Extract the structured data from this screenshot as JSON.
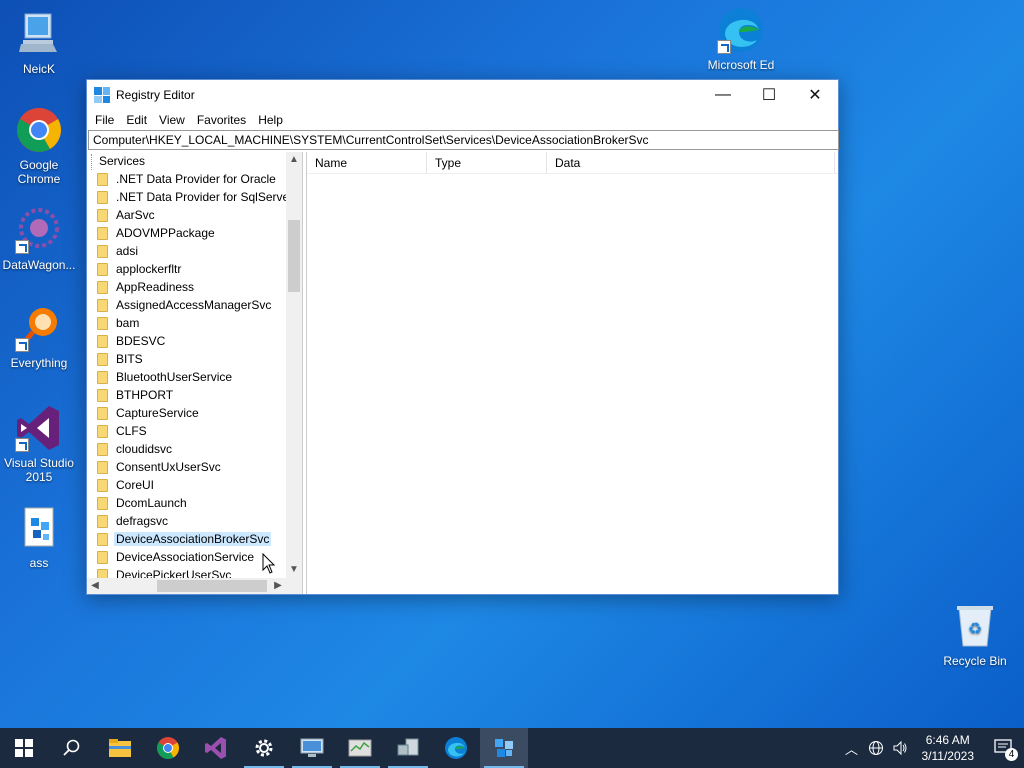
{
  "desktop": {
    "icons": [
      {
        "label": "NeicK",
        "icon": "computer-icon"
      },
      {
        "label": "Google Chrome",
        "icon": "chrome-icon"
      },
      {
        "label": "DataWagon...",
        "icon": "datawagon-icon"
      },
      {
        "label": "Everything",
        "icon": "everything-icon"
      },
      {
        "label": "Visual Studio 2015",
        "icon": "visual-studio-icon"
      },
      {
        "label": "ass",
        "icon": "file-icon"
      },
      {
        "label": "Microsoft Ed",
        "icon": "edge-icon"
      },
      {
        "label": "Recycle Bin",
        "icon": "recycle-bin-icon"
      }
    ]
  },
  "window": {
    "title": "Registry Editor",
    "minimize": "—",
    "maximize": "☐",
    "close": "✕",
    "menu": [
      "File",
      "Edit",
      "View",
      "Favorites",
      "Help"
    ],
    "address": "Computer\\HKEY_LOCAL_MACHINE\\SYSTEM\\CurrentControlSet\\Services\\DeviceAssociationBrokerSvc",
    "tree": {
      "root": "Services",
      "items": [
        ".NET Data Provider for Oracle",
        ".NET Data Provider for SqlServer",
        "AarSvc",
        "ADOVMPPackage",
        "adsi",
        "applockerfltr",
        "AppReadiness",
        "AssignedAccessManagerSvc",
        "bam",
        "BDESVC",
        "BITS",
        "BluetoothUserService",
        "BTHPORT",
        "CaptureService",
        "CLFS",
        "cloudidsvc",
        "ConsentUxUserSvc",
        "CoreUI",
        "DcomLaunch",
        "defragsvc",
        "DeviceAssociationBrokerSvc",
        "DeviceAssociationService",
        "DevicePickerUserSvc"
      ],
      "selected_index": 20
    },
    "columns": [
      "Name",
      "Type",
      "Data"
    ]
  },
  "taskbar": {
    "pinned": [
      "start-icon",
      "search-icon",
      "file-explorer-icon",
      "chrome-icon",
      "visual-studio-icon",
      "settings-icon",
      "remote-desktop-icon",
      "task-manager-icon",
      "network-computer-icon",
      "edge-icon",
      "registry-editor-icon"
    ],
    "time": "6:46 AM",
    "date": "3/11/2023",
    "notification_count": "4"
  },
  "colors": {
    "accent": "#0078d7",
    "taskbar": "#1b2a3e",
    "selection": "#cce8ff"
  }
}
